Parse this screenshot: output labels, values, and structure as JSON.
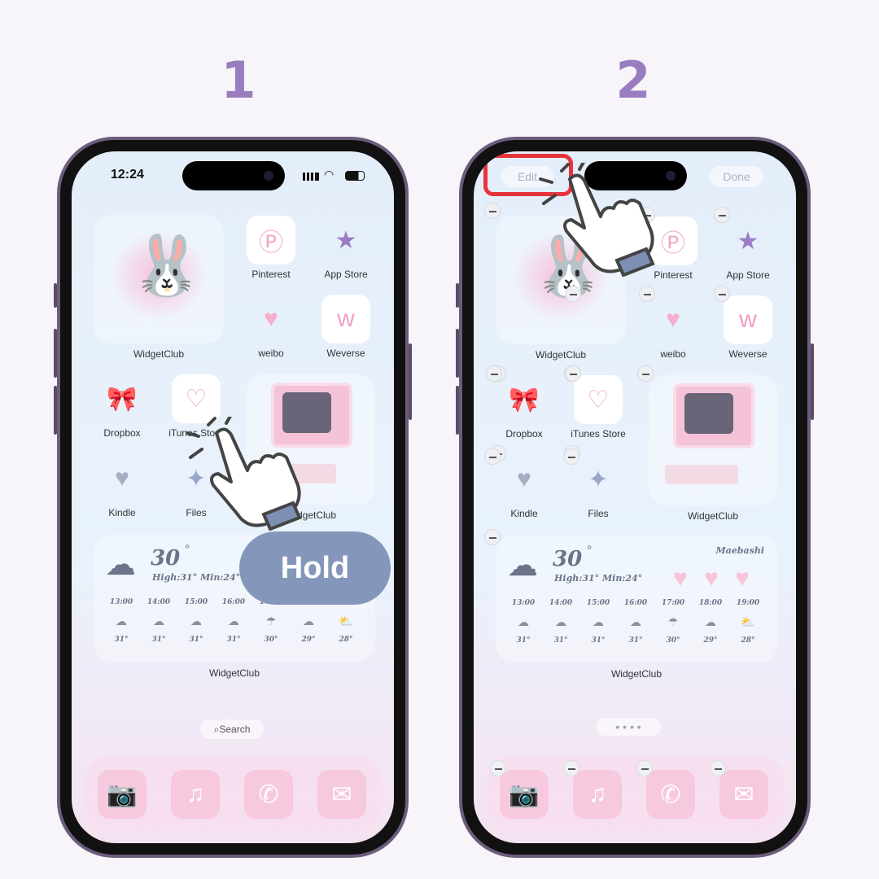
{
  "steps": [
    "1",
    "2"
  ],
  "phone1": {
    "time": "12:24",
    "search": "Search",
    "overlay": "Hold"
  },
  "phone2": {
    "edit": "Edit",
    "done": "Done",
    "city": "Maebashi"
  },
  "apps": {
    "bunny_widget": "WidgetClub",
    "pinterest": "Pinterest",
    "app_store": "App Store",
    "weibo": "weibo",
    "weverse": "Weverse",
    "dropbox": "Dropbox",
    "itunes": "iTunes Store",
    "computer_widget": "WidgetClub",
    "kindle": "Kindle",
    "files": "Files",
    "weather_widget": "WidgetClub"
  },
  "weather": {
    "temp": "30",
    "degree": "°",
    "high_low": "High:31° Min:24°",
    "hours": [
      "13:00",
      "14:00",
      "15:00",
      "16:00",
      "17:00",
      "18:00",
      "19:00"
    ],
    "icons": [
      "cloud-icon",
      "cloud-icon",
      "cloud-icon",
      "cloud-icon",
      "umbrella-icon",
      "cloud-icon",
      "cloud-sun-icon"
    ],
    "temps": [
      "31°",
      "31°",
      "31°",
      "31°",
      "30°",
      "29°",
      "28°"
    ]
  },
  "dock": [
    {
      "name": "camera-icon",
      "glyph": "📷"
    },
    {
      "name": "music-icon",
      "glyph": "♫"
    },
    {
      "name": "phone-icon",
      "glyph": "✆"
    },
    {
      "name": "mail-icon",
      "glyph": "✉"
    }
  ],
  "colors": {
    "accent": "#9a7cc0",
    "hold": "#8497bb",
    "highlight": "#e8333a"
  }
}
